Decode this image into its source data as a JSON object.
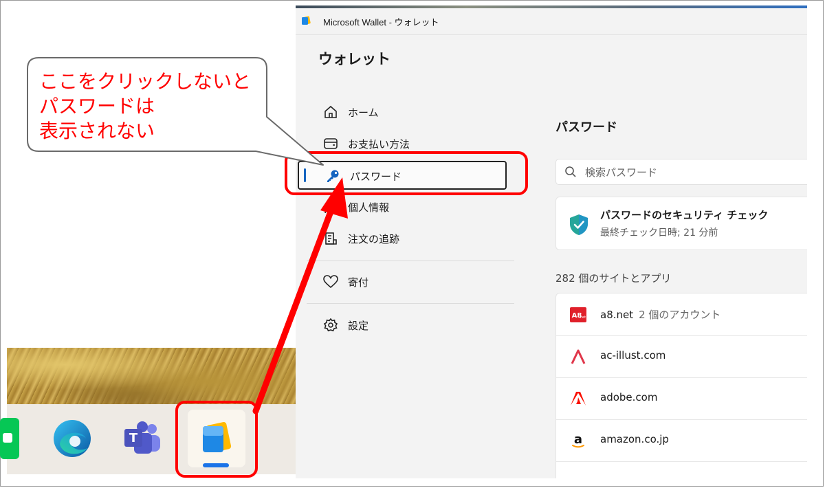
{
  "window": {
    "title": "Microsoft Wallet - ウォレット",
    "app_heading": "ウォレット"
  },
  "nav": {
    "items": [
      {
        "label": "ホーム",
        "icon": "home-icon"
      },
      {
        "label": "お支払い方法",
        "icon": "wallet-card-icon"
      },
      {
        "label": "パスワード",
        "icon": "key-icon",
        "active": true
      },
      {
        "label": "個人情報",
        "icon": "person-icon"
      },
      {
        "label": "注文の追跡",
        "icon": "receipt-icon"
      },
      {
        "label": "寄付",
        "icon": "heart-icon"
      },
      {
        "label": "設定",
        "icon": "gear-icon"
      }
    ]
  },
  "main": {
    "heading": "パスワード",
    "search_placeholder": "検索パスワード",
    "security_check": {
      "title": "パスワードのセキュリティ チェック",
      "subtitle": "最終チェック日時; 21 分前"
    },
    "count_label": "282 個のサイトとアプリ",
    "sites": [
      {
        "name": "a8.net",
        "accounts": "2 個のアカウント",
        "logo": "a8-logo"
      },
      {
        "name": "ac-illust.com",
        "accounts": "",
        "logo": "ac-illust-logo"
      },
      {
        "name": "adobe.com",
        "accounts": "",
        "logo": "adobe-logo"
      },
      {
        "name": "amazon.co.jp",
        "accounts": "",
        "logo": "amazon-logo"
      }
    ]
  },
  "callout": {
    "line1": "ここをクリックしないと",
    "line2": "パスワードは",
    "line3": "表示されない"
  },
  "colors": {
    "highlight": "#ff0000",
    "accent": "#1565c0"
  }
}
